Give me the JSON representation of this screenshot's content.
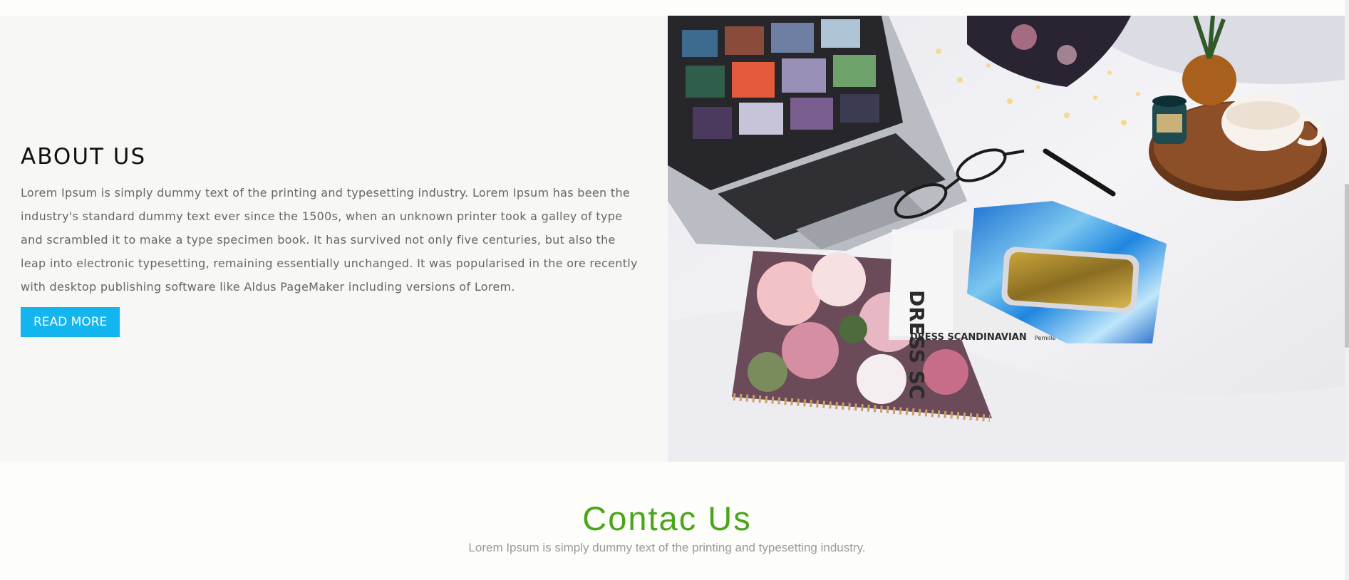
{
  "about": {
    "title": "ABOUT US",
    "body": "Lorem Ipsum is simply dummy text of the printing and typesetting industry. Lorem Ipsum has been the industry's standard dummy text ever since the 1500s, when an unknown printer took a galley of type and scrambled it to make a type specimen book. It has survived not only five centuries, but also the leap into electronic typesetting, remaining essentially unchanged. It was popularised in the ore recently with desktop publishing software like Aldus PageMaker including versions of Lorem.",
    "button_label": "READ MORE",
    "photo": {
      "book_cover_title": "DRESS SCANDINAVIAN",
      "book_cover_author": "Pernille Teisbaek",
      "book_spine_text": "DRESS SC"
    }
  },
  "contact": {
    "title": "Contac Us",
    "subtitle": "Lorem Ipsum is simply dummy text of the printing and typesetting industry."
  },
  "colors": {
    "accent_button": "#12b5ee",
    "contact_title": "#4aa51a",
    "about_bg": "#f7f7f5",
    "page_bg": "#fdfdf9"
  }
}
